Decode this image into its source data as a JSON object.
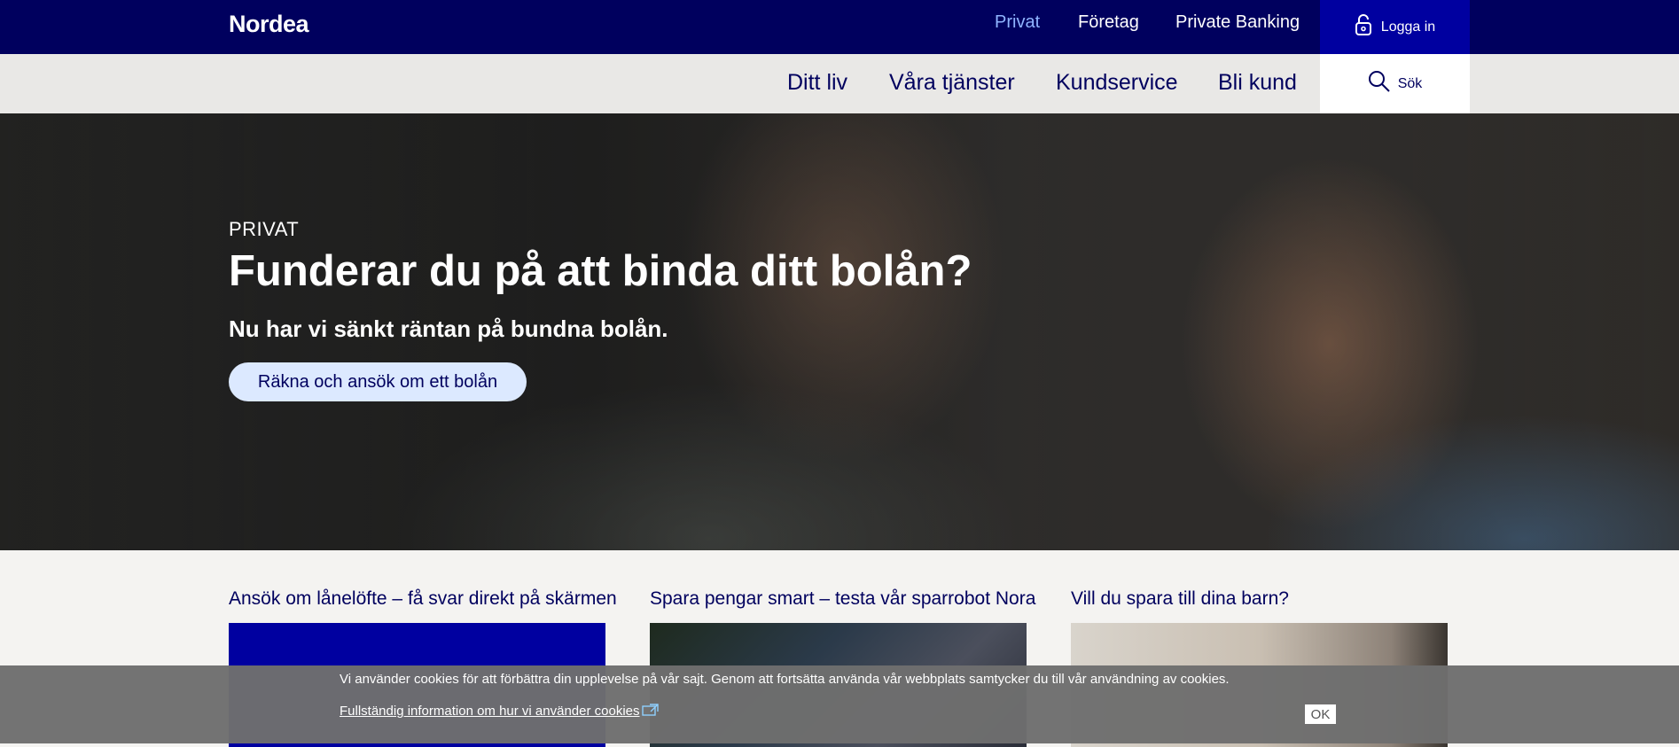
{
  "header": {
    "logo": "Nordea",
    "top_nav": [
      "Privat",
      "Företag",
      "Private Banking"
    ],
    "login_label": "Logga in",
    "sub_nav": [
      "Ditt liv",
      "Våra tjänster",
      "Kundservice",
      "Bli kund"
    ],
    "search_label": "Sök"
  },
  "hero": {
    "eyebrow": "PRIVAT",
    "title": "Funderar du på att binda ditt bolån?",
    "subtitle": "Nu har vi sänkt räntan på bundna bolån.",
    "cta_label": "Räkna och ansök om ett bolån"
  },
  "cards": [
    {
      "title": "Ansök om lånelöfte – få svar direkt på skärmen"
    },
    {
      "title": "Spara pengar smart – testa vår sparrobot Nora"
    },
    {
      "title": "Vill du spara till dina barn?"
    }
  ],
  "cookie_banner": {
    "text": "Vi använder cookies för att förbättra din upplevelse på vår sajt. Genom att fortsätta använda vår webbplats samtycker du till vår användning av cookies.",
    "link_text": "Fullständig information om hur vi använder cookies",
    "ok_label": "OK"
  },
  "colors": {
    "brand_dark": "#00005e",
    "brand_blue": "#0000a0",
    "active_nav": "#8fb4ff",
    "cta_background": "#dce9ff"
  }
}
